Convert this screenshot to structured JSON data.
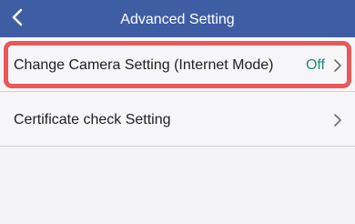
{
  "header": {
    "title": "Advanced Setting",
    "back_icon": "chevron-left-icon"
  },
  "settings": {
    "items": [
      {
        "label": "Change Camera Setting (Internet Mode)",
        "value": "Off",
        "icon": "chevron-right-icon",
        "highlighted": true
      },
      {
        "label": "Certificate check Setting",
        "value": "",
        "icon": "chevron-right-icon",
        "highlighted": false
      }
    ]
  },
  "colors": {
    "header_bg": "#3f5da3",
    "value_text": "#1f8a7a",
    "highlight_border": "#e8585a",
    "background": "#f4f4f6"
  }
}
